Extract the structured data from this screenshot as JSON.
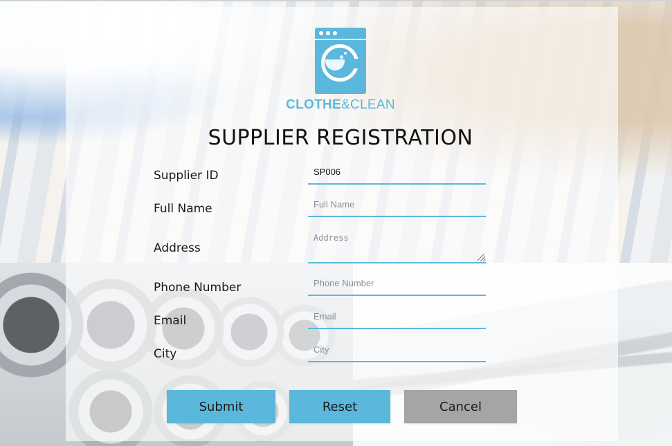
{
  "brand": {
    "name_bold": "CLOTHE",
    "name_rest": "&CLEAN",
    "color": "#5bb8dc"
  },
  "page_title": "SUPPLIER REGISTRATION",
  "form": {
    "supplier_id": {
      "label": "Supplier ID",
      "value": "SP006",
      "placeholder": ""
    },
    "full_name": {
      "label": "Full Name",
      "value": "",
      "placeholder": "Full Name"
    },
    "address": {
      "label": "Address",
      "value": "",
      "placeholder": "Address"
    },
    "phone": {
      "label": "Phone Number",
      "value": "",
      "placeholder": "Phone Number"
    },
    "email": {
      "label": "Email",
      "value": "",
      "placeholder": "Email"
    },
    "city": {
      "label": "City",
      "value": "",
      "placeholder": "City"
    }
  },
  "buttons": {
    "submit": "Submit",
    "reset": "Reset",
    "cancel": "Cancel"
  },
  "colors": {
    "accent": "#5bb8dc",
    "cancel": "#a3a5a7"
  }
}
